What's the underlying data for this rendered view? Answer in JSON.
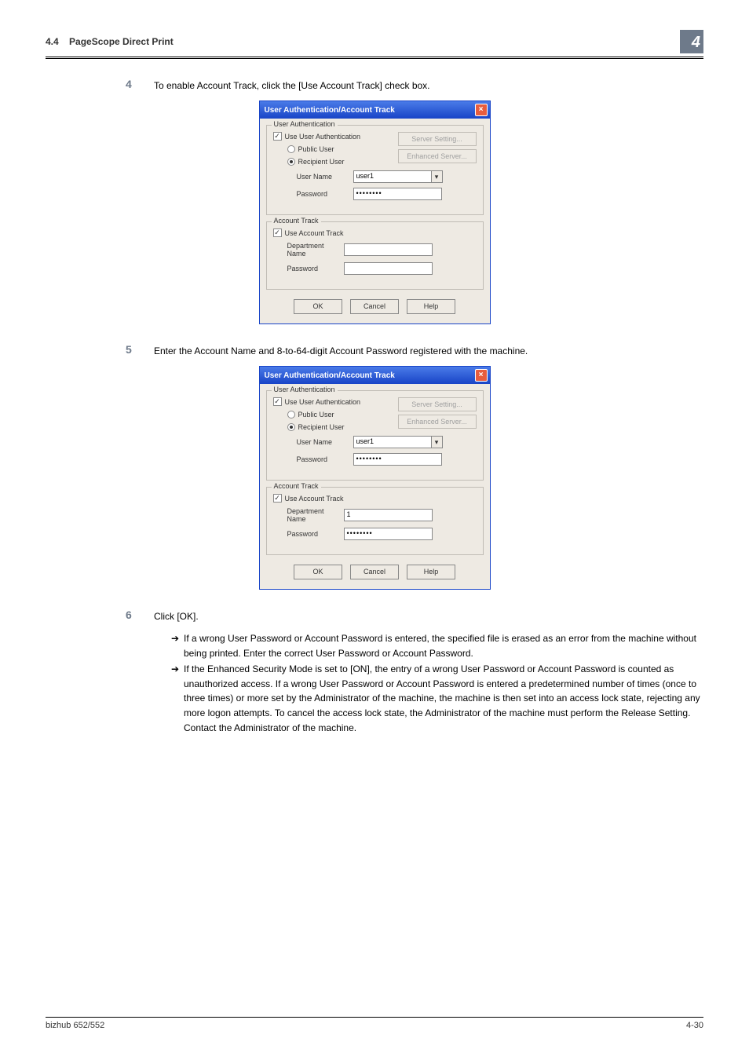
{
  "header": {
    "section_number": "4.4",
    "section_title": "PageScope Direct Print",
    "chapter_badge": "4"
  },
  "steps": {
    "s4": {
      "num": "4",
      "text": "To enable Account Track, click the [Use Account Track] check box."
    },
    "s5": {
      "num": "5",
      "text": "Enter the Account Name and 8-to-64-digit Account Password registered with the machine."
    },
    "s6": {
      "num": "6",
      "text": "Click [OK]."
    }
  },
  "notes": {
    "n1": "If a wrong User Password or Account Password is entered, the specified file is erased as an error from the machine without being printed. Enter the correct User Password or Account Password.",
    "n2": "If the Enhanced Security Mode is set to [ON], the entry of a wrong User Password or Account Password is counted as unauthorized access. If a wrong User Password or Account Password is entered a predetermined number of times (once to three times) or more set by the Administrator of the machine, the machine is then set into an access lock state, rejecting any more logon attempts. To cancel the access lock state, the Administrator of the machine must perform the Release Setting. Contact the Administrator of the machine."
  },
  "dialog": {
    "title": "User Authentication/Account Track",
    "auth_legend": "User Authentication",
    "use_auth_label": "Use User Authentication",
    "public_user": "Public User",
    "recipient_user": "Recipient User",
    "user_name_label": "User Name",
    "user_name_value": "user1",
    "password_label": "Password",
    "password_mask": "••••••••",
    "server_setting_btn": "Server Setting...",
    "enhanced_server_btn": "Enhanced Server...",
    "track_legend": "Account Track",
    "use_track_label": "Use Account Track",
    "dept_name_label": "Department Name",
    "dept_name_value_d2": "1",
    "track_pwd_label": "Password",
    "ok": "OK",
    "cancel": "Cancel",
    "help": "Help"
  },
  "footer": {
    "product": "bizhub 652/552",
    "page": "4-30"
  },
  "arrow": "➔"
}
